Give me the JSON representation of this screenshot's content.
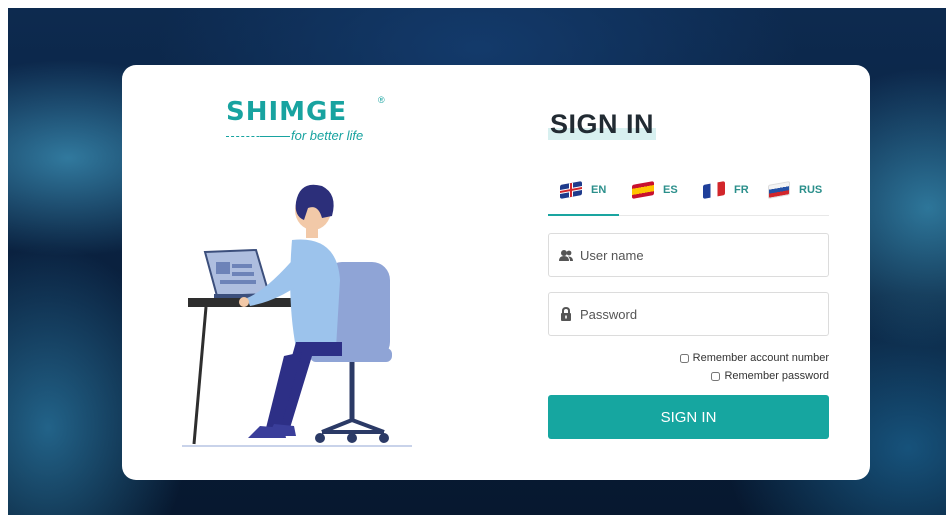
{
  "brand": {
    "name": "SHIMGE",
    "registered_mark": "®",
    "tagline": "for better life",
    "color": "#18a3a0"
  },
  "signin": {
    "title": "SIGN IN",
    "languages": [
      {
        "code": "EN",
        "flag": "uk-flag-icon",
        "active": true
      },
      {
        "code": "ES",
        "flag": "spain-flag-icon",
        "active": false
      },
      {
        "code": "FR",
        "flag": "france-flag-icon",
        "active": false
      },
      {
        "code": "RUS",
        "flag": "russia-flag-icon",
        "active": false
      }
    ],
    "username_placeholder": "User name",
    "password_placeholder": "Password",
    "remember_account": "Remember account number",
    "remember_password": "Remember password",
    "button_label": "SIGN IN",
    "accent_color": "#16a6a0"
  }
}
